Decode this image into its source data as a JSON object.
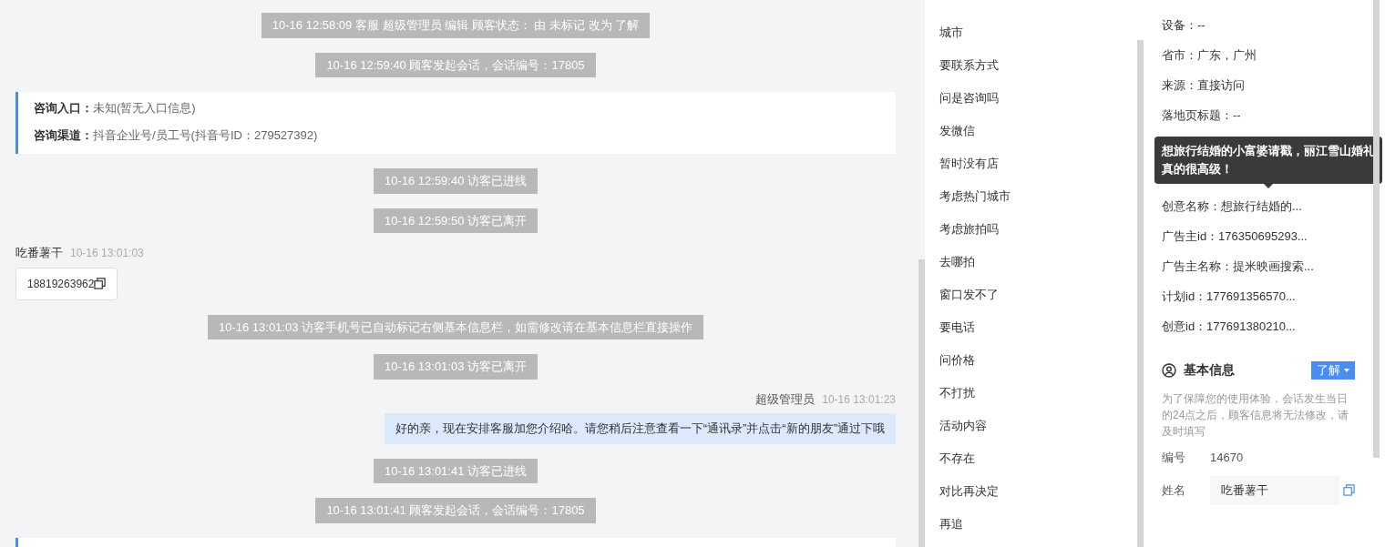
{
  "chat": [
    {
      "kind": "system",
      "text": "10-16 12:58:09 客服 超级管理员 编辑 顾客状态： 由 未标记 改为 了解"
    },
    {
      "kind": "system",
      "text": "10-16 12:59:40 顾客发起会话，会话编号：17805"
    },
    {
      "kind": "info_card",
      "lines": [
        {
          "label": "咨询入口：",
          "value": "未知(暂无入口信息)"
        },
        {
          "label": "咨询渠道：",
          "value": "抖音企业号/员工号(抖音号ID：279527392)"
        }
      ]
    },
    {
      "kind": "system",
      "text": "10-16 12:59:40 访客已进线"
    },
    {
      "kind": "system",
      "text": "10-16 12:59:50 访客已离开"
    },
    {
      "kind": "visitor",
      "name": "吃番薯干",
      "time": "10-16 13:01:03",
      "text": "18819263962"
    },
    {
      "kind": "system",
      "text": "10-16 13:01:03 访客手机号已自动标记右侧基本信息栏，如需修改请在基本信息栏直接操作"
    },
    {
      "kind": "system",
      "text": "10-16 13:01:03 访客已离开"
    },
    {
      "kind": "agent",
      "name": "超级管理员",
      "time": "10-16 13:01:23",
      "text": "好的亲，现在安排客服加您介绍哈。请您稍后注意查看一下“通讯录”并点击“新的朋友”通过下哦"
    },
    {
      "kind": "system",
      "text": "10-16 13:01:41 访客已进线"
    },
    {
      "kind": "system",
      "text": "10-16 13:01:41 顾客发起会话，会话编号：17805"
    },
    {
      "kind": "info_card"
    }
  ],
  "tags": [
    "城市",
    "要联系方式",
    "问是咨询吗",
    "发微信",
    "暂时没有店",
    "考虑热门城市",
    "考虑旅拍吗",
    "去哪拍",
    "窗口发不了",
    "要电话",
    "问价格",
    "不打扰",
    "活动内容",
    "不存在",
    "对比再决定",
    "再追"
  ],
  "details_top": [
    "设备：--",
    "省市：广东，广州",
    "来源：直接访问",
    "落地页标题：--"
  ],
  "tooltip": "想旅行结婚的小富婆请戳，丽江雪山婚礼真的很高级！",
  "details_bottom": [
    "创意名称：想旅行结婚的...",
    "广告主id：176350695293...",
    "广告主名称：提米映画搜索...",
    "计划id：177691356570...",
    "创意id：177691380210..."
  ],
  "basic_info": {
    "title": "基本信息",
    "status": "了解",
    "note": "为了保障您的使用体验，会话发生当日的24点之后，顾客信息将无法修改，请及时填写",
    "fields": [
      {
        "kind": "text",
        "label": "编号",
        "value": "14670"
      },
      {
        "kind": "input",
        "label": "姓名",
        "value": "吃番薯干"
      }
    ]
  }
}
